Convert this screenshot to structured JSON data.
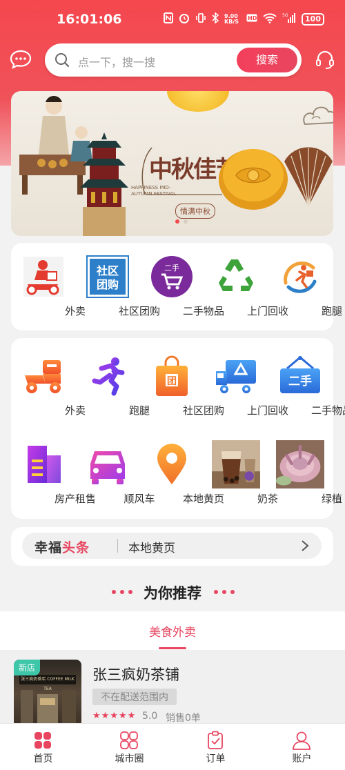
{
  "status_bar": {
    "time": "16:01:06",
    "network_speed": "9.00 KB/S",
    "signal": "5G",
    "battery": "100"
  },
  "search": {
    "placeholder": "点一下，搜一搜",
    "button_label": "搜索"
  },
  "banner": {
    "title": "中秋佳节",
    "subtitle": "HAPPINESS MID-AUTUMN FESTIVAL",
    "seal": "情满中秋",
    "slide_count": 2,
    "active_slide": 1
  },
  "quick_services": [
    {
      "label": "外卖",
      "icon": "delivery-rider-icon"
    },
    {
      "label": "社区团购",
      "icon": "community-group-buy-icon"
    },
    {
      "label": "二手物品",
      "icon": "second-hand-cart-icon"
    },
    {
      "label": "上门回收",
      "icon": "recycle-icon"
    },
    {
      "label": "跑腿",
      "icon": "errand-runner-icon"
    }
  ],
  "services": [
    {
      "label": "外卖",
      "icon": "scooter-icon"
    },
    {
      "label": "跑腿",
      "icon": "running-man-icon"
    },
    {
      "label": "社区团购",
      "icon": "shopping-bag-icon"
    },
    {
      "label": "上门回收",
      "icon": "delivery-truck-icon"
    },
    {
      "label": "二手物品",
      "icon": "hanging-sign-icon"
    },
    {
      "label": "房产租售",
      "icon": "building-icon"
    },
    {
      "label": "顺风车",
      "icon": "car-icon"
    },
    {
      "label": "本地黄页",
      "icon": "location-pin-icon"
    },
    {
      "label": "奶茶",
      "icon": "milk-tea-photo"
    },
    {
      "label": "绿植",
      "icon": "succulent-photo"
    }
  ],
  "news": {
    "brand_part1": "幸福",
    "brand_part2": "头条",
    "text": "本地黄页"
  },
  "recommend": {
    "title": "为你推荐",
    "tab": "美食外卖"
  },
  "shop": {
    "badge": "新店",
    "sign": "张三疯奶茶店 COFFEE MILK TEA",
    "name": "张三疯奶茶铺",
    "range": "不在配送范围内",
    "stars": 5,
    "rating": "5.0",
    "sales": "销售0单"
  },
  "nav": [
    {
      "label": "首页",
      "icon": "home-grid-icon",
      "active": true
    },
    {
      "label": "城市圈",
      "icon": "city-circle-icon",
      "active": false
    },
    {
      "label": "订单",
      "icon": "order-clipboard-icon",
      "active": false
    },
    {
      "label": "账户",
      "icon": "account-user-icon",
      "active": false
    }
  ],
  "colors": {
    "brand": "#e84560",
    "header": "#f5474e",
    "new_badge": "#3ec6a8"
  }
}
